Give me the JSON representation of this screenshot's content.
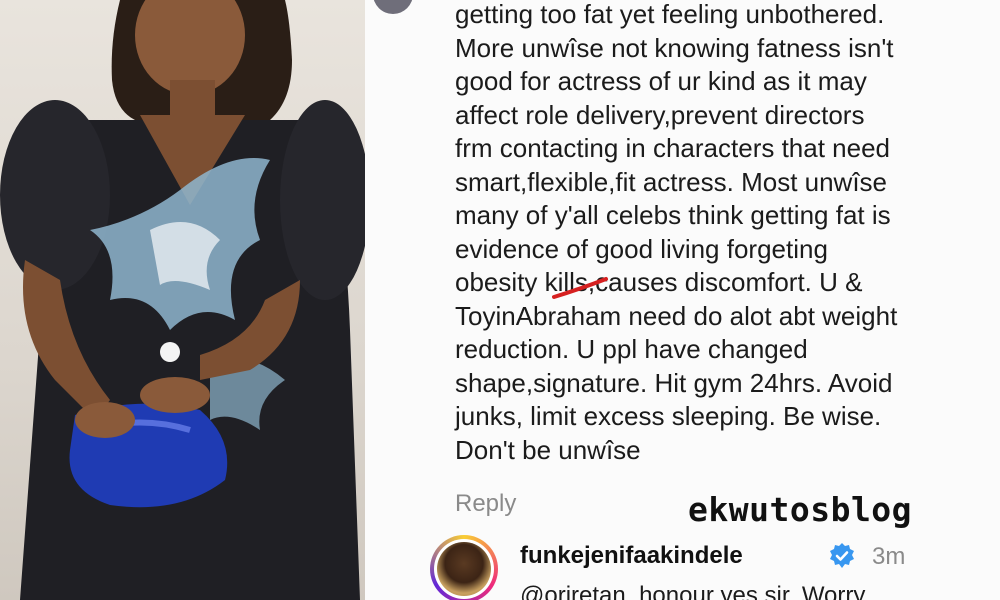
{
  "comment": {
    "lines": [
      "getting too fat yet feeling unbothered.",
      "More unwîse not knowing fatness isn't",
      "good for actress of ur kind as it may",
      "affect role delivery,prevent directors",
      "frm contacting in characters that need",
      "smart,flexible,fit actress. Most unwîse",
      "many of y'all celebs think getting fat is",
      "evidence of good living forgeting",
      "obesity kills,causes discomfort. U &",
      "ToyinAbraham need do alot abt weight",
      "reduction. U ppl have changed",
      "shape,signature. Hit gym 24hrs. Avoid",
      "junks, limit excess sleeping. Be wise.",
      "Don't be unwîse"
    ],
    "reply_label": "Reply"
  },
  "watermark": "ekwutosblog",
  "reply": {
    "username": "funkejenifaakindele",
    "time": "3m",
    "text": "@oriretan_honour yes sir. Worry"
  },
  "colors": {
    "verified": "#3897f0",
    "strike": "#d62020",
    "dress": "#1f1f24",
    "clutch": "#1f3bb3"
  }
}
